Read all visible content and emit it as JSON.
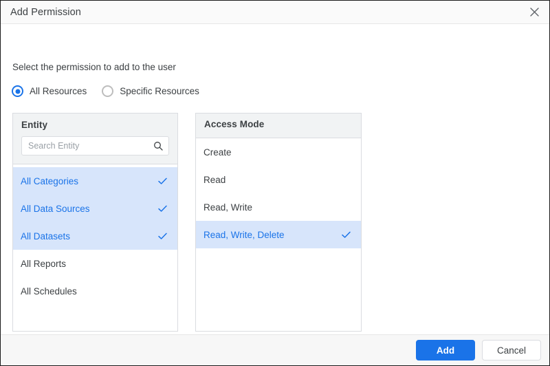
{
  "dialog": {
    "title": "Add Permission",
    "close_icon": "close-icon",
    "subtitle": "Select the permission to add to the user"
  },
  "scope": {
    "options": [
      {
        "label": "All Resources",
        "selected": true
      },
      {
        "label": "Specific Resources",
        "selected": false
      }
    ]
  },
  "entity_panel": {
    "title": "Entity",
    "search": {
      "placeholder": "Search Entity",
      "value": "",
      "icon": "search-icon"
    },
    "items": [
      {
        "label": "All Categories",
        "selected": true
      },
      {
        "label": "All Data Sources",
        "selected": true
      },
      {
        "label": "All Datasets",
        "selected": true
      },
      {
        "label": "All Reports",
        "selected": false
      },
      {
        "label": "All Schedules",
        "selected": false
      }
    ]
  },
  "access_panel": {
    "title": "Access Mode",
    "items": [
      {
        "label": "Create",
        "selected": false
      },
      {
        "label": "Read",
        "selected": false
      },
      {
        "label": "Read, Write",
        "selected": false
      },
      {
        "label": "Read, Write, Delete",
        "selected": true
      }
    ]
  },
  "footer": {
    "add_label": "Add",
    "cancel_label": "Cancel"
  },
  "colors": {
    "accent": "#1a73e8",
    "selected_row_bg": "#d7e5fb",
    "panel_header_bg": "#f1f3f4",
    "panel_border": "#dadce0",
    "titlebar_bg": "#fafafa",
    "footer_bg": "#f7f7f7",
    "text": "#3c4043",
    "placeholder": "#9aa0a6"
  }
}
